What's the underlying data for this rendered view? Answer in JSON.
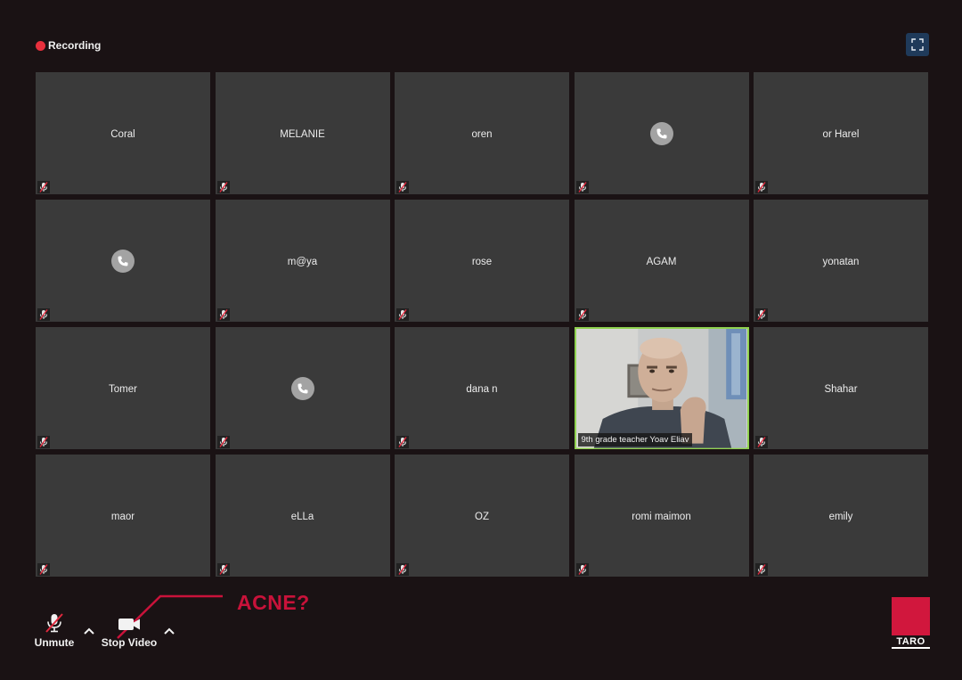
{
  "header": {
    "recording_label": "Recording"
  },
  "participants": {
    "coral": "Coral",
    "melanie": "MELANIE",
    "oren": "oren",
    "or_harel": "or Harel",
    "maya": "m@ya",
    "rose": "rose",
    "agam": "AGAM",
    "yonatan": "yonatan",
    "tomer": "Tomer",
    "dana_n": "dana n",
    "yoav": "9th grade teacher Yoav Eliav",
    "shahar": "Shahar",
    "maor": "maor",
    "ella": "eLLa",
    "oz": "OZ",
    "romi": "romi maimon",
    "emily": "emily"
  },
  "toolbar": {
    "unmute_label": "Unmute",
    "stop_video_label": "Stop Video"
  },
  "annotation": {
    "text": "ACNE?"
  },
  "logo": {
    "text": "TARO"
  },
  "colors": {
    "background": "#1a1214",
    "tile": "#3a3a3a",
    "active_speaker_border": "#8fd14f",
    "recording_dot": "#e8303d",
    "annotation": "#c9123a",
    "logo": "#d1173d"
  },
  "icons": {
    "tile_mute": "muted-mic-icon",
    "phone": "phone-icon",
    "fullscreen": "fullscreen-icon",
    "mic": "muted-mic-icon",
    "video": "video-off-icon",
    "chevron": "chevron-up-icon"
  }
}
